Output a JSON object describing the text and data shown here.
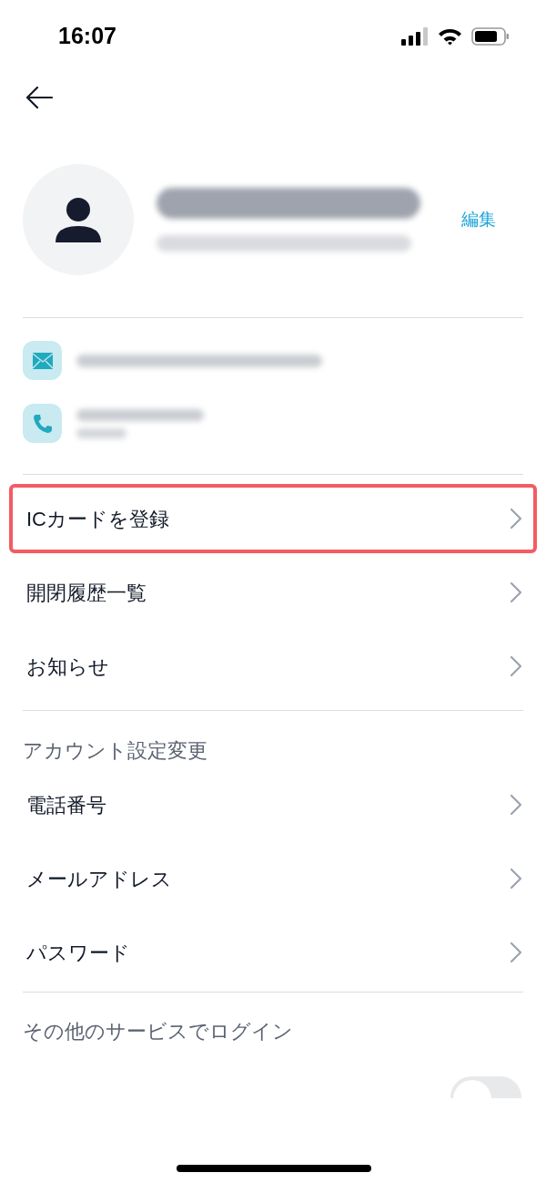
{
  "status_bar": {
    "time": "16:07"
  },
  "profile": {
    "edit": "編集"
  },
  "menu": [
    {
      "label": "ICカードを登録",
      "highlighted": true
    },
    {
      "label": "開閉履歴一覧",
      "highlighted": false
    },
    {
      "label": "お知らせ",
      "highlighted": false
    }
  ],
  "account_settings": {
    "title": "アカウント設定変更",
    "items": [
      {
        "label": "電話番号"
      },
      {
        "label": "メールアドレス"
      },
      {
        "label": "パスワード"
      }
    ]
  },
  "other_login": {
    "title": "その他のサービスでログイン",
    "toggle": {
      "on": false
    }
  }
}
